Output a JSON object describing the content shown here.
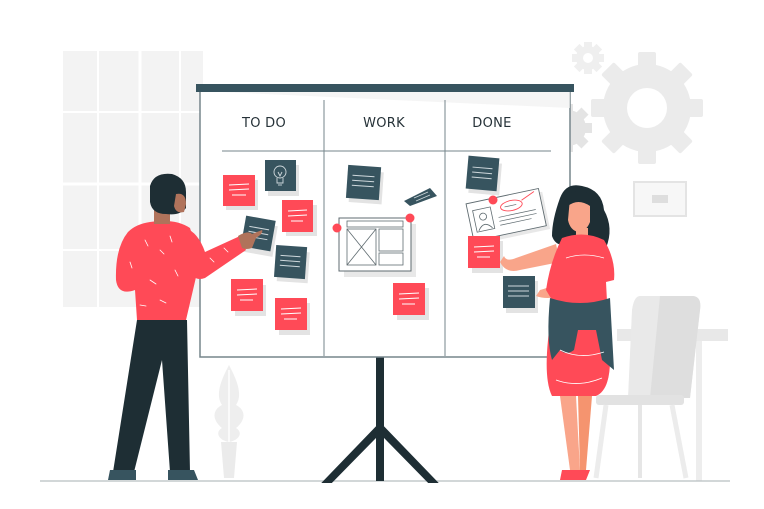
{
  "board": {
    "columns": [
      {
        "label": "TO DO"
      },
      {
        "label": "WORK"
      },
      {
        "label": "DONE"
      }
    ]
  },
  "colors": {
    "accent_red": "#ff4a57",
    "dark_slate": "#37545f",
    "dark_navy": "#1e2e34",
    "skin": "#f9a58a",
    "skin_dark": "#b0735b",
    "bg_gray": "#f3f3f3",
    "light_gray": "#e6e6e6"
  }
}
